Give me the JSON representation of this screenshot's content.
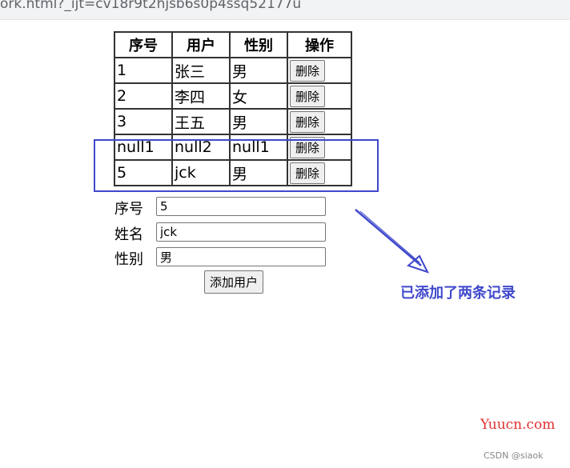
{
  "browser": {
    "url": "ork.html?_ijt=cv18r9t2hjsb6s0p4ssq52177u"
  },
  "table": {
    "headers": [
      "序号",
      "用户",
      "性别",
      "操作"
    ],
    "rows": [
      {
        "id": "1",
        "user": "张三",
        "gender": "男",
        "action": "删除"
      },
      {
        "id": "2",
        "user": "李四",
        "gender": "女",
        "action": "删除"
      },
      {
        "id": "3",
        "user": "王五",
        "gender": "男",
        "action": "删除"
      },
      {
        "id": "null1",
        "user": "null2",
        "gender": "null1",
        "action": "删除"
      },
      {
        "id": "5",
        "user": "jck",
        "gender": "男",
        "action": "删除"
      }
    ]
  },
  "form": {
    "id_label": "序号",
    "id_value": "5",
    "name_label": "姓名",
    "name_value": "jck",
    "gender_label": "性别",
    "gender_value": "男",
    "submit_label": "添加用户"
  },
  "annotation": {
    "text": "已添加了两条记录",
    "color": "#3f48cc"
  },
  "watermark": {
    "site": "Yuucn.com",
    "credit": "CSDN @siaok"
  }
}
